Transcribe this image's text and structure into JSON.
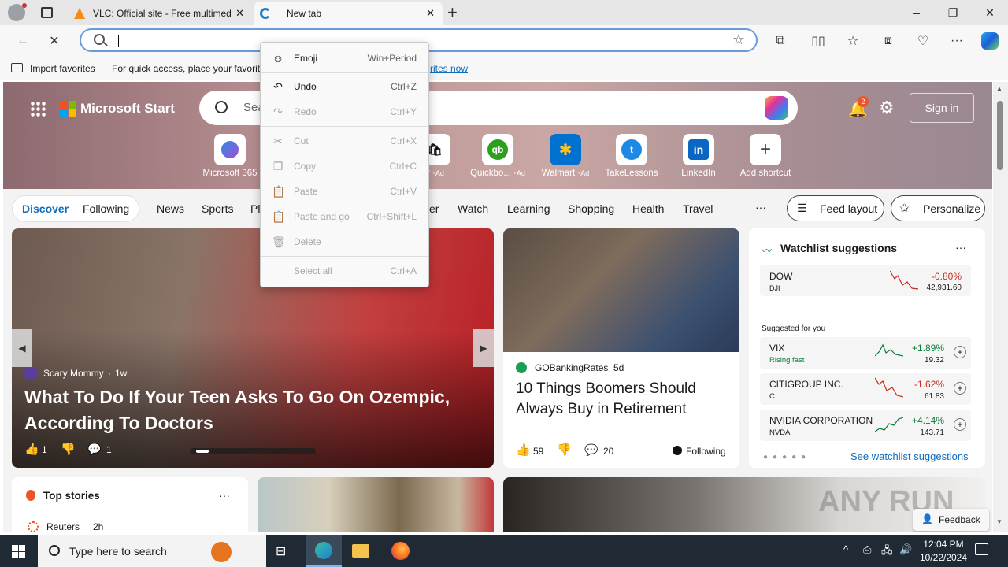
{
  "browser": {
    "tabs": [
      {
        "title": "VLC: Official site - Free multimed",
        "active": false
      },
      {
        "title": "New tab",
        "active": true
      }
    ],
    "new_tab_symbol": "+",
    "window_controls": {
      "minimize": "–",
      "maximize": "❐",
      "close": "✕"
    },
    "address": {
      "value": "",
      "placeholder": ""
    },
    "favbar": {
      "import_label": "Import favorites",
      "hint": "For quick access, place your favorite",
      "hint_tail": "rites now"
    }
  },
  "context_menu": {
    "items": [
      {
        "label": "Emoji",
        "shortcut": "Win+Period",
        "icon": "emoji-icon",
        "disabled": false
      },
      {
        "label": "Undo",
        "shortcut": "Ctrl+Z",
        "icon": "undo-icon",
        "disabled": false
      },
      {
        "label": "Redo",
        "shortcut": "Ctrl+Y",
        "icon": "redo-icon",
        "disabled": true
      },
      {
        "label": "Cut",
        "shortcut": "Ctrl+X",
        "icon": "cut-icon",
        "disabled": true
      },
      {
        "label": "Copy",
        "shortcut": "Ctrl+C",
        "icon": "copy-icon",
        "disabled": true
      },
      {
        "label": "Paste",
        "shortcut": "Ctrl+V",
        "icon": "paste-icon",
        "disabled": true
      },
      {
        "label": "Paste and go",
        "shortcut": "Ctrl+Shift+L",
        "icon": "paste-go-icon",
        "disabled": true
      },
      {
        "label": "Delete",
        "shortcut": "",
        "icon": "delete-icon",
        "disabled": true
      },
      {
        "label": "Select all",
        "shortcut": "Ctrl+A",
        "icon": "",
        "disabled": true
      }
    ]
  },
  "msn": {
    "brand": "Microsoft Start",
    "search_placeholder": "Sea",
    "notif_count": "2",
    "signin": "Sign in",
    "shortcuts": [
      {
        "label": "Microsoft 365",
        "ad": ""
      },
      {
        "label": "y",
        "ad": "Ad"
      },
      {
        "label": "Quickbo...",
        "ad": "Ad"
      },
      {
        "label": "Walmart",
        "ad": "Ad"
      },
      {
        "label": "TakeLessons",
        "ad": ""
      },
      {
        "label": "LinkedIn",
        "ad": ""
      },
      {
        "label": "Add shortcut",
        "ad": ""
      }
    ],
    "nav": {
      "discover": "Discover",
      "following": "Following",
      "items": [
        "News",
        "Sports",
        "Pl",
        "er",
        "Watch",
        "Learning",
        "Shopping",
        "Health",
        "Travel"
      ],
      "more": "···",
      "feed_layout": "Feed layout",
      "personalize": "Personalize"
    },
    "hero_story": {
      "source": "Scary Mommy",
      "age": "1w",
      "title": "What To Do If Your Teen Asks To Go On Ozempic, According To Doctors",
      "likes": "1",
      "comments": "1"
    },
    "side_story": {
      "source": "GOBankingRates",
      "age": "5d",
      "title": "10 Things Boomers Should Always Buy in Retirement",
      "likes": "59",
      "comments": "20",
      "following": "Following"
    },
    "watchlist": {
      "title": "Watchlist suggestions",
      "more": "···",
      "dow": {
        "name": "DOW",
        "sym": "DJI",
        "change": "-0.80%",
        "value": "42,931.60"
      },
      "suggested_label": "Suggested for you",
      "stocks": [
        {
          "name": "VIX",
          "sub": "Rising fast",
          "change": "+1.89%",
          "value": "19.32",
          "up": true
        },
        {
          "name": "CITIGROUP INC.",
          "sub": "C",
          "change": "-1.62%",
          "value": "61.83",
          "up": false
        },
        {
          "name": "NVIDIA CORPORATION",
          "sub": "NVDA",
          "change": "+4.14%",
          "value": "143.71",
          "up": true
        }
      ],
      "see_all": "See watchlist suggestions"
    },
    "top_stories": {
      "title": "Top stories",
      "more": "···",
      "first_source": "Reuters",
      "first_age": "2h"
    },
    "feedback": "Feedback",
    "watermark": "ANY RUN"
  },
  "taskbar": {
    "search_placeholder": "Type here to search",
    "time": "12:04 PM",
    "date": "10/22/2024"
  },
  "colors": {
    "accent": "#0f6cbd",
    "green": "#0a7d3b",
    "red": "#c42b1c",
    "taskbar": "#1f2a35"
  }
}
